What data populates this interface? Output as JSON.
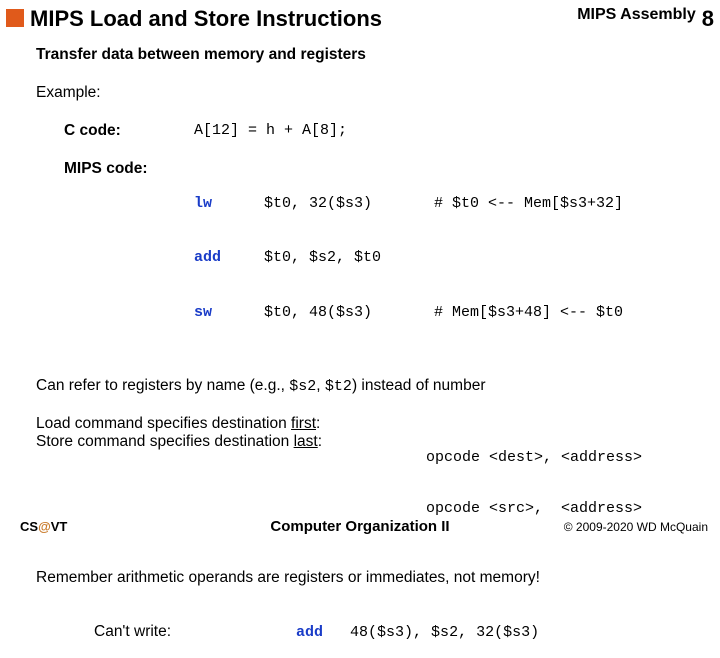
{
  "header": {
    "title": "MIPS Load and Store Instructions",
    "course": "MIPS Assembly",
    "page": "8"
  },
  "body": {
    "intro": "Transfer data between memory and registers",
    "example_label": "Example:",
    "ccode_label": "C code:",
    "ccode": "A[12] = h + A[8];",
    "mips_label": "MIPS code:",
    "asm": {
      "op1": "lw",
      "arg1": "$t0, 32($s3)",
      "c1": "# $t0 <-- Mem[$s3+32]",
      "op2": "add",
      "arg2": "$t0, $s2, $t0",
      "op3": "sw",
      "arg3": "$t0, 48($s3)",
      "c3": "# Mem[$s3+48] <-- $t0"
    },
    "refer_pre": "Can refer to registers by name (e.g., ",
    "refer_r1": "$s2",
    "refer_mid": ", ",
    "refer_r2": "$t2",
    "refer_post": ") instead of number",
    "load_pre": "Load command specifies destination ",
    "load_word": "first",
    "colon": ":",
    "store_pre": "Store command specifies destination ",
    "store_word": "last",
    "opcode_dest": "opcode <dest>, <address>",
    "opcode_src": "opcode <src>,  <address>",
    "remember": "Remember arithmetic operands are registers or immediates, not memory!",
    "cant_label": "Can't write:",
    "cant_op": "add",
    "cant_args": "48($s3), $s2, 32($s3)"
  },
  "footer": {
    "left_a": "CS",
    "left_at": "@",
    "left_b": "VT",
    "center": "Computer Organization II",
    "right": "© 2009-2020 WD McQuain"
  }
}
